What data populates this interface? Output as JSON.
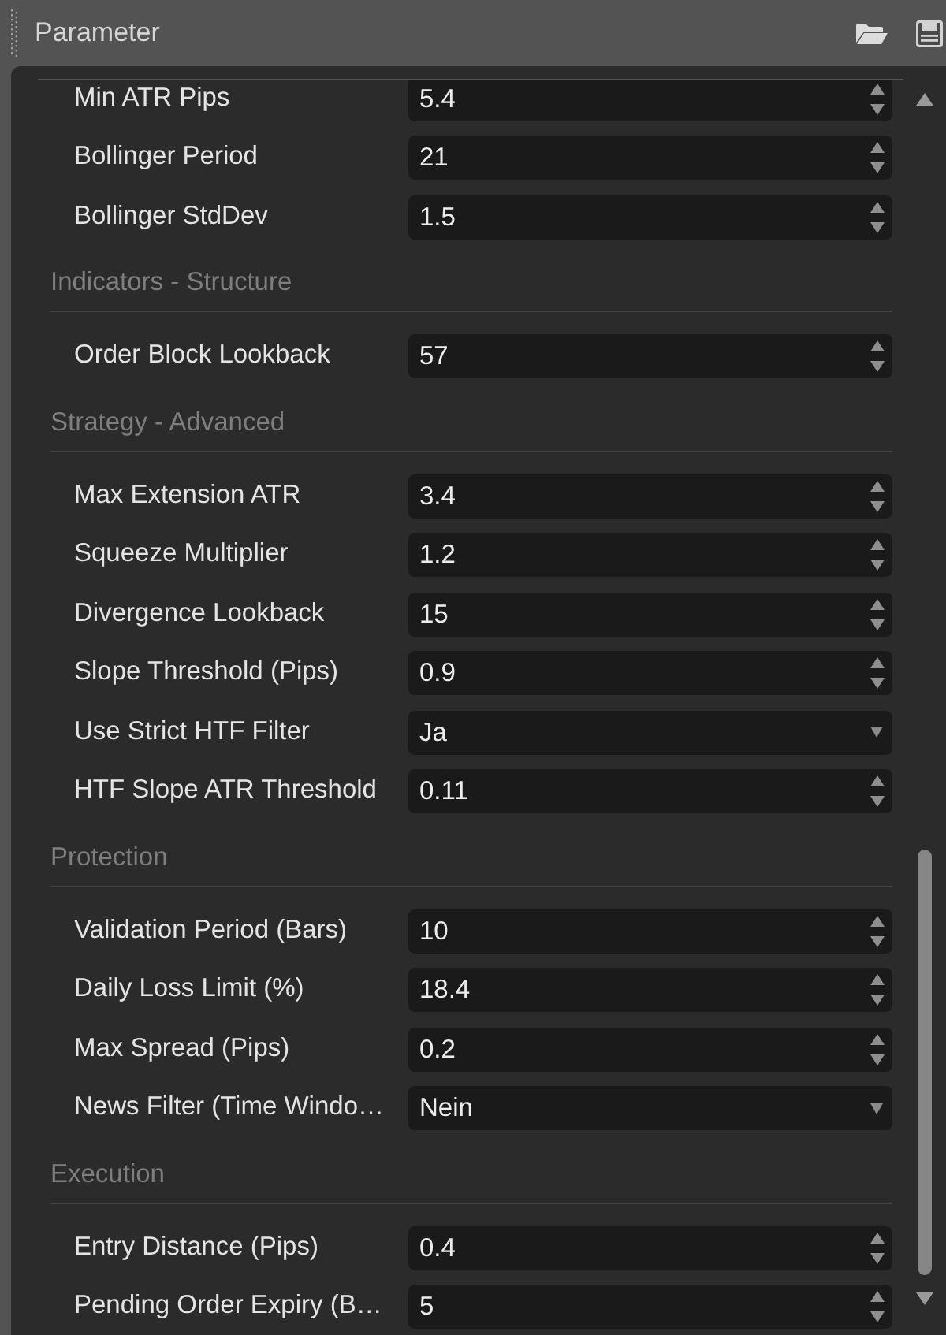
{
  "window": {
    "title": "Parameter"
  },
  "groups": [
    {
      "rows": [
        {
          "label": "Min ATR Pips",
          "kind": "number",
          "value": "5.4"
        },
        {
          "label": "Bollinger Period",
          "kind": "number",
          "value": "21"
        },
        {
          "label": "Bollinger StdDev",
          "kind": "number",
          "value": "1.5"
        }
      ]
    },
    {
      "title": "Indicators - Structure",
      "rows": [
        {
          "label": "Order Block Lookback",
          "kind": "number",
          "value": "57"
        }
      ]
    },
    {
      "title": "Strategy - Advanced",
      "rows": [
        {
          "label": "Max Extension ATR",
          "kind": "number",
          "value": "3.4"
        },
        {
          "label": "Squeeze Multiplier",
          "kind": "number",
          "value": "1.2"
        },
        {
          "label": "Divergence Lookback",
          "kind": "number",
          "value": "15"
        },
        {
          "label": "Slope Threshold (Pips)",
          "kind": "number",
          "value": "0.9"
        },
        {
          "label": "Use Strict HTF Filter",
          "kind": "dropdown",
          "value": "Ja"
        },
        {
          "label": "HTF Slope ATR Threshold",
          "kind": "number",
          "value": "0.11"
        }
      ]
    },
    {
      "title": "Protection",
      "rows": [
        {
          "label": "Validation Period (Bars)",
          "kind": "number",
          "value": "10"
        },
        {
          "label": "Daily Loss Limit (%)",
          "kind": "number",
          "value": "18.4"
        },
        {
          "label": "Max Spread (Pips)",
          "kind": "number",
          "value": "0.2"
        },
        {
          "label": "News Filter (Time Windo…",
          "kind": "dropdown",
          "value": "Nein"
        }
      ]
    },
    {
      "title": "Execution",
      "rows": [
        {
          "label": "Entry Distance (Pips)",
          "kind": "number",
          "value": "0.4"
        },
        {
          "label": "Pending Order Expiry (B…",
          "kind": "number",
          "value": "5"
        }
      ]
    }
  ]
}
